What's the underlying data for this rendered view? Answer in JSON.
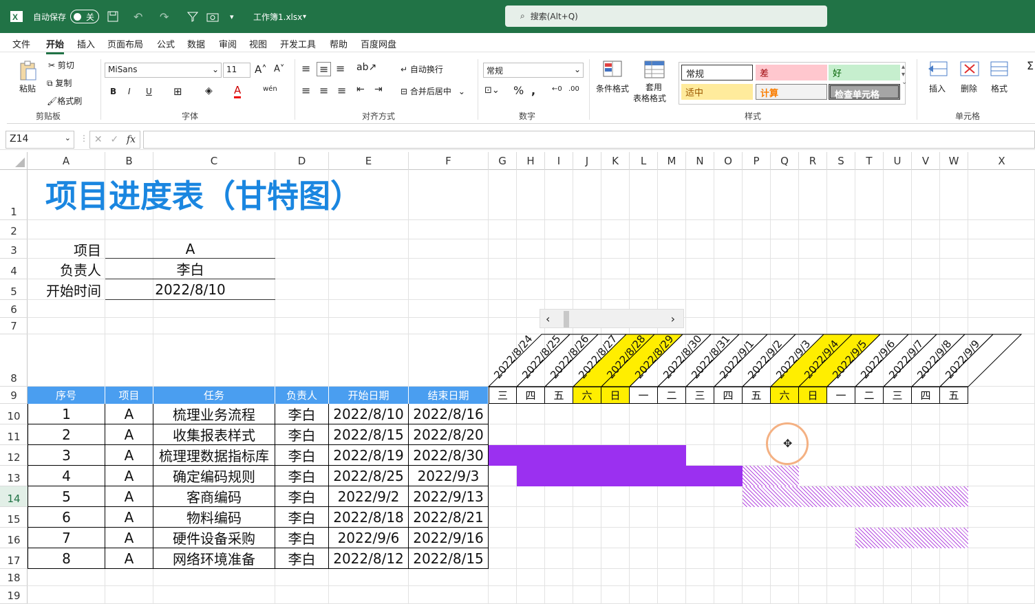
{
  "titlebar": {
    "autosave": "自动保存",
    "toggle": "关",
    "filename": "工作簿1.xlsx",
    "search": "搜索(Alt+Q)"
  },
  "menu": [
    "文件",
    "开始",
    "插入",
    "页面布局",
    "公式",
    "数据",
    "审阅",
    "视图",
    "开发工具",
    "帮助",
    "百度网盘"
  ],
  "ribbon": {
    "clipboard": {
      "paste": "粘贴",
      "cut": "剪切",
      "copy": "复制",
      "format_painter": "格式刷",
      "label": "剪贴板"
    },
    "font": {
      "name": "MiSans",
      "size": "11",
      "label": "字体",
      "bold": "B",
      "italic": "I",
      "underline": "U"
    },
    "align": {
      "wrap": "自动换行",
      "merge": "合并后居中",
      "label": "对齐方式"
    },
    "number": {
      "format": "常规",
      "label": "数字"
    },
    "styles": {
      "cond": "条件格式",
      "table1": "套用",
      "table2": "表格格式",
      "normal": "常规",
      "bad": "差",
      "good": "好",
      "neutral": "适中",
      "calc": "计算",
      "check": "检查单元格",
      "label": "样式"
    },
    "cells": {
      "insert": "插入",
      "delete": "删除",
      "format": "格式",
      "label": "单元格"
    }
  },
  "formula": {
    "namebox": "Z14",
    "fx": "fx"
  },
  "columns": [
    "A",
    "B",
    "C",
    "D",
    "E",
    "F",
    "G",
    "H",
    "I",
    "J",
    "K",
    "L",
    "M",
    "N",
    "O",
    "P",
    "Q",
    "R",
    "S",
    "T",
    "U",
    "V",
    "W",
    "X"
  ],
  "rows": [
    "1",
    "2",
    "3",
    "4",
    "5",
    "6",
    "7",
    "8",
    "9",
    "10",
    "11",
    "12",
    "13",
    "14",
    "15",
    "16",
    "17",
    "18",
    "19"
  ],
  "sheet": {
    "title": "项目进度表（甘特图）",
    "info": [
      {
        "label": "项目",
        "value": "A"
      },
      {
        "label": "负责人",
        "value": "李白"
      },
      {
        "label": "开始时间",
        "value": "2022/8/10"
      }
    ],
    "headers": [
      "序号",
      "项目",
      "任务",
      "负责人",
      "开始日期",
      "结束日期"
    ],
    "tasks": [
      [
        "1",
        "A",
        "梳理业务流程",
        "李白",
        "2022/8/10",
        "2022/8/16"
      ],
      [
        "2",
        "A",
        "收集报表样式",
        "李白",
        "2022/8/15",
        "2022/8/20"
      ],
      [
        "3",
        "A",
        "梳理理数据指标库",
        "李白",
        "2022/8/19",
        "2022/8/30"
      ],
      [
        "4",
        "A",
        "确定编码规则",
        "李白",
        "2022/8/25",
        "2022/9/3"
      ],
      [
        "5",
        "A",
        "客商编码",
        "李白",
        "2022/9/2",
        "2022/9/13"
      ],
      [
        "6",
        "A",
        "物料编码",
        "李白",
        "2022/8/18",
        "2022/8/21"
      ],
      [
        "7",
        "A",
        "硬件设备采购",
        "李白",
        "2022/9/6",
        "2022/9/16"
      ],
      [
        "8",
        "A",
        "网络环境准备",
        "李白",
        "2022/8/12",
        "2022/8/15"
      ]
    ],
    "dates": [
      "2022/8/24",
      "2022/8/25",
      "2022/8/26",
      "2022/8/27",
      "2022/8/28",
      "2022/8/29",
      "2022/8/30",
      "2022/8/31",
      "2022/9/1",
      "2022/9/2",
      "2022/9/3",
      "2022/9/4",
      "2022/9/5",
      "2022/9/6",
      "2022/9/7",
      "2022/9/8",
      "2022/9/9"
    ],
    "weekdays": [
      "三",
      "四",
      "五",
      "六",
      "日",
      "一",
      "二",
      "三",
      "四",
      "五",
      "六",
      "日",
      "一",
      "二",
      "三",
      "四",
      "五"
    ],
    "weekend_color": "#ffee00",
    "bar_color": "#9b30f0"
  }
}
